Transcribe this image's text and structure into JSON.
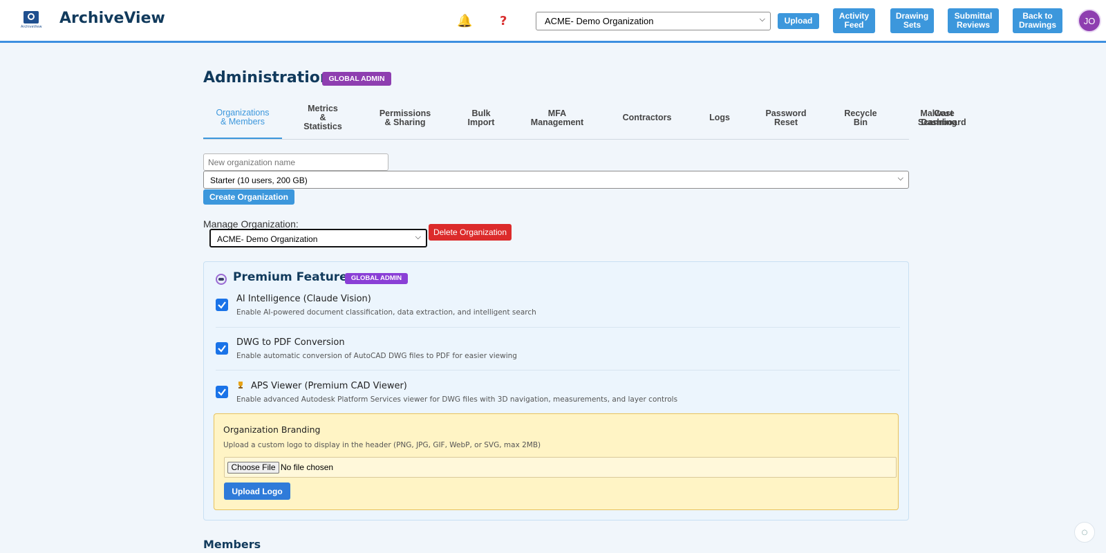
{
  "app": {
    "logo_text": "ArchiveView",
    "name": "ArchiveView"
  },
  "header": {
    "bell_icon": "bell-icon",
    "help_icon": "help-icon",
    "org_selected": "ACME- Demo Organization",
    "buttons": {
      "upload": "Upload",
      "activity_feed": [
        "Activity",
        "Feed"
      ],
      "drawing_sets": [
        "Drawing",
        "Sets"
      ],
      "submittal_reviews": [
        "Submittal",
        "Reviews"
      ],
      "back_to_drawings": [
        "Back to",
        "Drawings"
      ]
    },
    "avatar_initials": "JO"
  },
  "page": {
    "title": "Administration",
    "badge": "GLOBAL ADMIN"
  },
  "tabs": [
    {
      "lines": [
        "Organizations",
        "& Members"
      ],
      "active": true
    },
    {
      "lines": [
        "Metrics",
        "&",
        "Statistics"
      ]
    },
    {
      "lines": [
        "Permissions",
        "& Sharing"
      ]
    },
    {
      "lines": [
        "Bulk",
        "Import"
      ]
    },
    {
      "lines": [
        "MFA",
        "Management"
      ]
    },
    {
      "lines": [
        "Contractors"
      ]
    },
    {
      "lines": [
        "Logs"
      ]
    },
    {
      "lines": [
        "Password",
        "Reset"
      ]
    },
    {
      "lines": [
        "Recycle",
        "Bin"
      ]
    },
    {
      "lines": [
        "Malware",
        "Scanning"
      ]
    },
    {
      "lines": [
        "Cost",
        "Dashboard"
      ]
    }
  ],
  "create_org": {
    "name_placeholder": "New organization name",
    "plan_selected": "Starter (10 users, 200 GB)",
    "create_button": "Create Organization"
  },
  "manage_org": {
    "label": "Manage Organization:",
    "selected": "ACME- Demo Organization",
    "delete_button": "Delete Organization"
  },
  "premium": {
    "title": "Premium Features",
    "badge": "GLOBAL ADMIN",
    "features": [
      {
        "title": "AI Intelligence (Claude Vision)",
        "desc": "Enable AI-powered document classification, data extraction, and intelligent search",
        "checked": true
      },
      {
        "title": "DWG to PDF Conversion",
        "desc": "Enable automatic conversion of AutoCAD DWG files to PDF for easier viewing",
        "checked": true
      },
      {
        "title": "APS Viewer (Premium CAD Viewer)",
        "desc": "Enable advanced Autodesk Platform Services viewer for DWG files with 3D navigation, measurements, and layer controls",
        "checked": true
      }
    ]
  },
  "branding": {
    "title": "Organization Branding",
    "desc": "Upload a custom logo to display in the header (PNG, JPG, GIF, WebP, or SVG, max 2MB)",
    "choose_file": "Choose File",
    "no_file": "No file chosen",
    "upload_button": "Upload Logo"
  },
  "members": {
    "title": "Members"
  },
  "colors": {
    "accent": "#3c97dc",
    "brand": "#113a5c",
    "admin_badge": "#8e3eb0",
    "danger": "#dc2b2b",
    "upload_logo": "#2f7bd9"
  }
}
